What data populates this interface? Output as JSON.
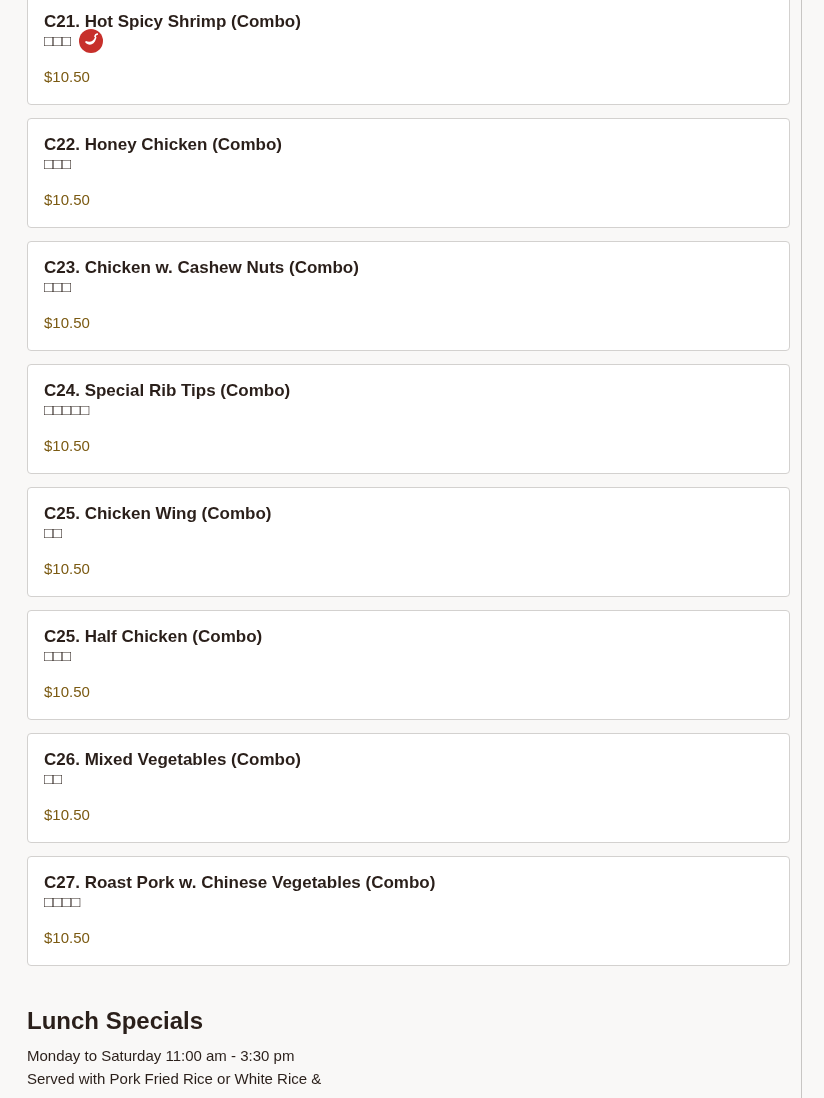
{
  "menu_items": [
    {
      "name": "C21. Hot Spicy Shrimp (Combo)",
      "chinese_name": "□□□",
      "spicy": true,
      "price": "$10.50"
    },
    {
      "name": "C22. Honey Chicken (Combo)",
      "chinese_name": "□□□",
      "spicy": false,
      "price": "$10.50"
    },
    {
      "name": "C23. Chicken w. Cashew Nuts (Combo)",
      "chinese_name": "□□□",
      "spicy": false,
      "price": "$10.50"
    },
    {
      "name": "C24. Special Rib Tips (Combo)",
      "chinese_name": "□□□□□",
      "spicy": false,
      "price": "$10.50"
    },
    {
      "name": "C25. Chicken Wing (Combo)",
      "chinese_name": "□□",
      "spicy": false,
      "price": "$10.50"
    },
    {
      "name": "C25. Half Chicken (Combo)",
      "chinese_name": "□□□",
      "spicy": false,
      "price": "$10.50"
    },
    {
      "name": "C26. Mixed Vegetables (Combo)",
      "chinese_name": "□□",
      "spicy": false,
      "price": "$10.50"
    },
    {
      "name": "C27. Roast Pork w. Chinese Vegetables (Combo)",
      "chinese_name": "□□□□",
      "spicy": false,
      "price": "$10.50"
    }
  ],
  "section": {
    "title": "Lunch Specials",
    "lines": [
      "Monday to Saturday 11:00 am - 3:30 pm",
      "Served with Pork Fried Rice or White Rice &"
    ]
  }
}
